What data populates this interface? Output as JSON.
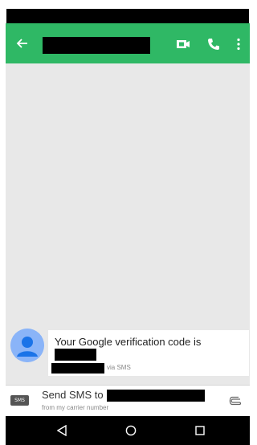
{
  "icons": {
    "back": "arrow-back-icon",
    "video": "video-call-icon",
    "phone": "phone-icon",
    "more": "more-vert-icon",
    "avatar": "person-avatar-icon",
    "attach": "paperclip-icon",
    "nav_back": "nav-back-icon",
    "nav_home": "nav-home-icon",
    "nav_recents": "nav-recents-icon"
  },
  "colors": {
    "app_bar": "#2fb865",
    "chat_background": "#e8e8e8",
    "avatar": "#8ab4f8"
  },
  "message": {
    "text": "Your Google verification code is",
    "via_label": "via SMS"
  },
  "compose": {
    "badge": "SMS",
    "send_prefix": "Send SMS to",
    "subtitle": "from my carrier number"
  }
}
